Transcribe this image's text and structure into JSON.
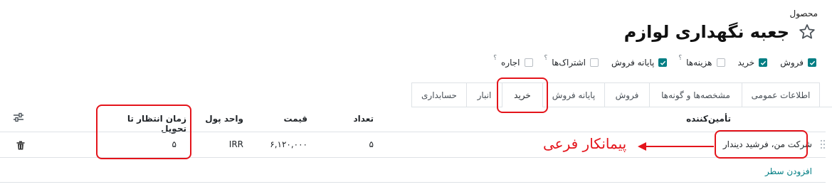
{
  "header": {
    "model_label": "محصول",
    "title": "جعبه نگهداری لوازم"
  },
  "options": [
    {
      "label": "فروش",
      "checked": true,
      "help": ""
    },
    {
      "label": "خرید",
      "checked": true,
      "help": ""
    },
    {
      "label": "هزینه‌ها",
      "checked": false,
      "help": "؟"
    },
    {
      "label": "پایانه فروش",
      "checked": true,
      "help": ""
    },
    {
      "label": "اشتراک‌ها",
      "checked": false,
      "help": "؟"
    },
    {
      "label": "اجاره",
      "checked": false,
      "help": "؟"
    }
  ],
  "tabs": [
    {
      "label": "اطلاعات عمومی"
    },
    {
      "label": "مشخصه‌ها و گونه‌ها"
    },
    {
      "label": "فروش"
    },
    {
      "label": "پایانه فروش"
    },
    {
      "label": "خرید",
      "active": true
    },
    {
      "label": "انبار"
    },
    {
      "label": "حسابداری"
    }
  ],
  "table": {
    "columns": {
      "vendor": "تأمین‌کننده",
      "quantity": "تعداد",
      "price": "قیمت",
      "currency": "واحد پول",
      "lead_time": "زمان انتظار تا تحویل"
    },
    "rows": [
      {
        "vendor": "شرکت من، فرشید دیندار",
        "quantity": "۵",
        "price": "۶,۱۲۰,۰۰۰",
        "currency": "IRR",
        "lead_time": "۵"
      }
    ],
    "add_line": "افزودن سطر"
  },
  "annotation": {
    "text": "پیمانکار فرعی",
    "color": "#e4141b"
  },
  "colors": {
    "accent": "#017e84",
    "highlight": "#e4141b"
  }
}
